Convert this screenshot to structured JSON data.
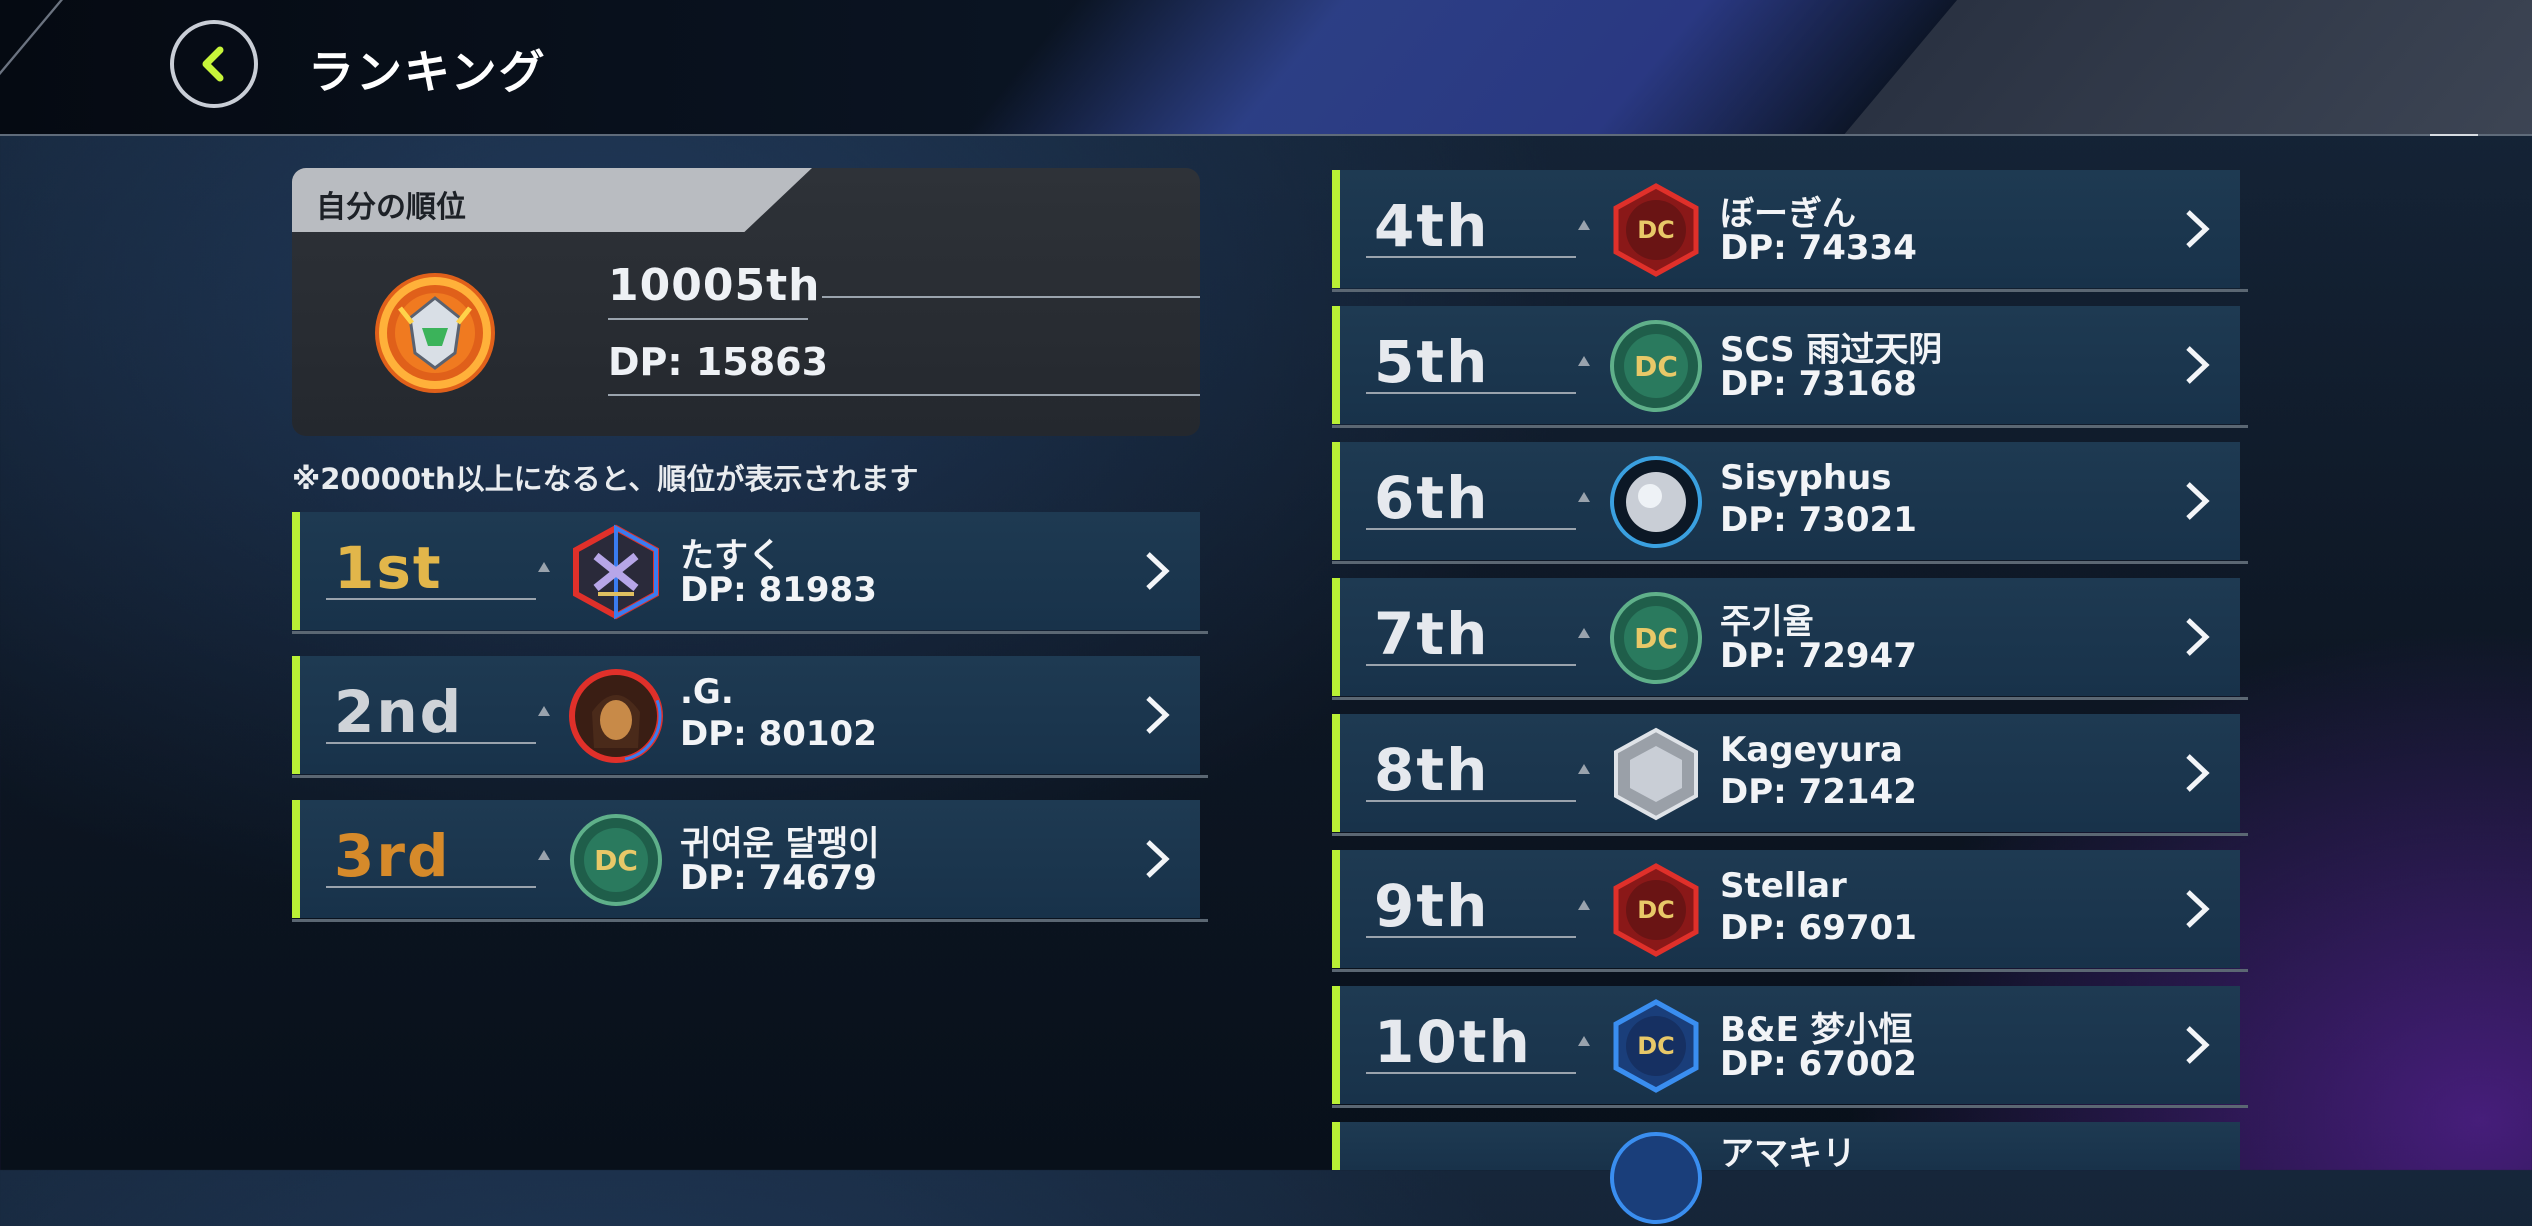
{
  "header": {
    "title": "ランキング"
  },
  "my_rank": {
    "section_label": "自分の順位",
    "rank": "10005th",
    "dp": "DP: 15863"
  },
  "note": "※20000th以上になると、順位が表示されます",
  "top3": [
    {
      "rank": "1st",
      "name": "たすく",
      "dp": "DP: 81983",
      "emblem": "crest-icon"
    },
    {
      "rank": "2nd",
      "name": ".G.",
      "dp": "DP: 80102",
      "emblem": "avatar-icon"
    },
    {
      "rank": "3rd",
      "name": "귀여운 달팽이",
      "dp": "DP: 74679",
      "emblem": "dc-medal-icon"
    }
  ],
  "list": [
    {
      "rank": "4th",
      "name": "ぼーぎん",
      "dp": "DP: 74334",
      "emblem": "dc-2025-dec-red-icon"
    },
    {
      "rank": "5th",
      "name": "SCS 雨过天阴",
      "dp": "DP: 73168",
      "emblem": "dc-2025-green-icon"
    },
    {
      "rank": "6th",
      "name": "Sisyphus",
      "dp": "DP: 73021",
      "emblem": "sphere-avatar-icon"
    },
    {
      "rank": "7th",
      "name": "주기율",
      "dp": "DP: 72947",
      "emblem": "dc-2025-green-icon"
    },
    {
      "rank": "8th",
      "name": "Kageyura",
      "dp": "DP: 72142",
      "emblem": "silver-hex-icon"
    },
    {
      "rank": "9th",
      "name": "Stellar",
      "dp": "DP: 69701",
      "emblem": "dc-2025-dec-red-icon"
    },
    {
      "rank": "10th",
      "name": "B&E 梦小恒",
      "dp": "DP: 67002",
      "emblem": "dc-2025-mar-blue-icon"
    },
    {
      "rank": "",
      "name": "アマキリ",
      "dp": "",
      "emblem": "avatar-icon"
    }
  ],
  "colors": {
    "accent": "#b9f035",
    "row_bg": "#1e3a52",
    "gold": "#e2b64a",
    "silver": "#cfd3d8",
    "bronze": "#d68a2a"
  }
}
